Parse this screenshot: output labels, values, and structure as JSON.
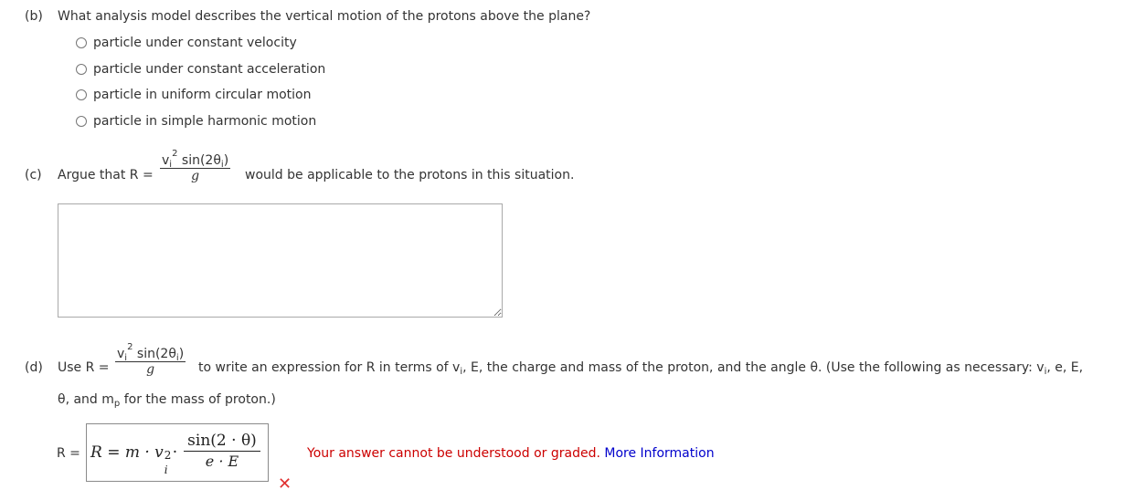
{
  "part_b": {
    "label": "(b)",
    "question": "What analysis model describes the vertical motion of the protons above the plane?",
    "options": [
      "particle under constant velocity",
      "particle under constant acceleration",
      "particle in uniform circular motion",
      "particle in simple harmonic motion"
    ]
  },
  "part_c": {
    "label": "(c)",
    "prefix": "Argue that R =",
    "frac_num_v": "v",
    "frac_num_sub": "i",
    "frac_num_sup": "2",
    "frac_num_sin": " sin(2θ",
    "frac_num_sin_sub": "i",
    "frac_num_close": ")",
    "frac_den": "g",
    "suffix": "would be applicable to the protons in this situation.",
    "textarea_value": ""
  },
  "part_d": {
    "label": "(d)",
    "use": "Use R =",
    "frac_num_v": "v",
    "frac_num_sub": "i",
    "frac_num_sup": "2",
    "frac_num_sin": " sin(2θ",
    "frac_num_sin_sub": "i",
    "frac_num_close": ")",
    "frac_den": "g",
    "text1": "to write an expression for R in terms of v",
    "text1_sub": "i",
    "text2": ", E, the charge and mass of the proton, and the angle θ. (Use the following as necessary: v",
    "text2_sub": "i",
    "text3": ", e, E,",
    "line2_a": "θ, and m",
    "line2_sub": "p",
    "line2_b": " for the mass of proton.)",
    "answer_label": "R =",
    "answer_lhs": "R = m · v",
    "answer_v_sup": "2",
    "answer_v_sub": "i",
    "answer_dot": "·",
    "answer_num": "sin(2 · θ)",
    "answer_den": "e · E",
    "error_text": "Your answer cannot be understood or graded.",
    "more_info": "More Information",
    "wrong_mark": "✕"
  }
}
